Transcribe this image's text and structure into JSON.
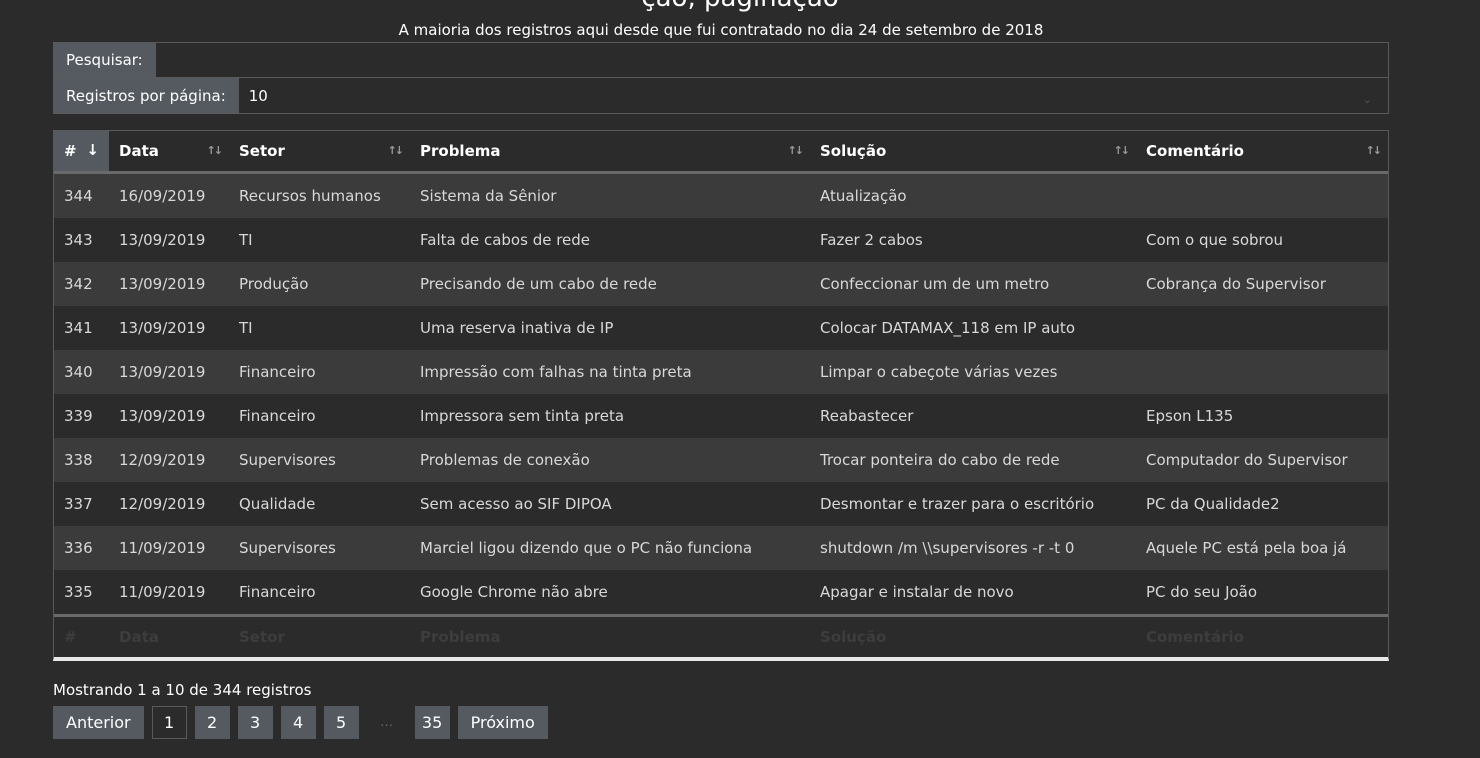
{
  "subtitle": "A maioria dos registros aqui desde que fui contratado no dia 24 de setembro de 2018",
  "controls": {
    "search_label": "Pesquisar:",
    "search_value": "",
    "per_page_label": "Registros por página:",
    "per_page_value": "10"
  },
  "table": {
    "headers": [
      "#",
      "Data",
      "Setor",
      "Problema",
      "Solução",
      "Comentário"
    ],
    "rows": [
      [
        "344",
        "16/09/2019",
        "Recursos humanos",
        "Sistema da Sênior",
        "Atualização",
        ""
      ],
      [
        "343",
        "13/09/2019",
        "TI",
        "Falta de cabos de rede",
        "Fazer 2 cabos",
        "Com o que sobrou"
      ],
      [
        "342",
        "13/09/2019",
        "Produção",
        "Precisando de um cabo de rede",
        "Confeccionar um de um metro",
        "Cobrança do Supervisor"
      ],
      [
        "341",
        "13/09/2019",
        "TI",
        "Uma reserva inativa de IP",
        "Colocar DATAMAX_118 em IP auto",
        ""
      ],
      [
        "340",
        "13/09/2019",
        "Financeiro",
        "Impressão com falhas na tinta preta",
        "Limpar o cabeçote várias vezes",
        ""
      ],
      [
        "339",
        "13/09/2019",
        "Financeiro",
        "Impressora sem tinta preta",
        "Reabastecer",
        "Epson L135"
      ],
      [
        "338",
        "12/09/2019",
        "Supervisores",
        "Problemas de conexão",
        "Trocar ponteira do cabo de rede",
        "Computador do Supervisor"
      ],
      [
        "337",
        "12/09/2019",
        "Qualidade",
        "Sem acesso ao SIF DIPOA",
        "Desmontar e trazer para o escritório",
        "PC da Qualidade2"
      ],
      [
        "336",
        "11/09/2019",
        "Supervisores",
        "Marciel ligou dizendo que o PC não funciona",
        "shutdown /m \\\\supervisores -r -t 0",
        "Aquele PC está pela boa já"
      ],
      [
        "335",
        "11/09/2019",
        "Financeiro",
        "Google Chrome não abre",
        "Apagar e instalar de novo",
        "PC do seu João"
      ]
    ]
  },
  "footer": {
    "info": "Mostrando 1 a 10 de 344 registros",
    "prev": "Anterior",
    "next": "Próximo",
    "pages": [
      "1",
      "2",
      "3",
      "4",
      "5",
      "…",
      "35"
    ]
  },
  "icons": {
    "sort_active": "arrow-down-icon",
    "sort_inactive": "sort-both-icon"
  }
}
